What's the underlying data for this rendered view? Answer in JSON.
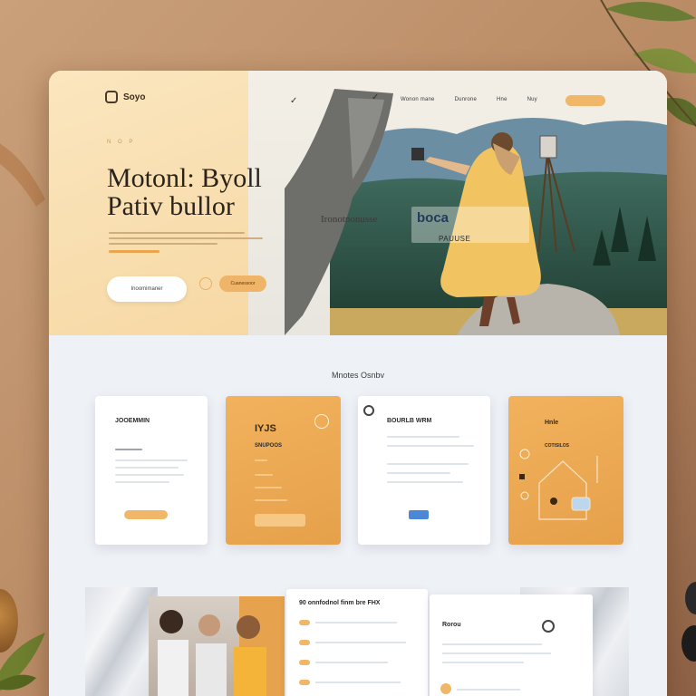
{
  "nav": {
    "brand": "Soyo",
    "links": [
      "Wonon mane",
      "Dunrone",
      "Hne",
      "Nuy"
    ]
  },
  "hero": {
    "eyebrow": "N O P",
    "headline_line1": "Motonl: Byoll",
    "headline_line2": "Pativ bullor",
    "primary_button": "Inoomimaner",
    "secondary_button": "Cuanessoor",
    "photo_caption_a": "Ironotnonusse",
    "photo_caption_b": "boca",
    "photo_caption_c": "PAUUSE"
  },
  "services": {
    "title": "Mnotes Osnbv",
    "cards": [
      {
        "title": "JOOEMMIN",
        "style": "white"
      },
      {
        "title": "IYJS",
        "subtitle": "SNUPOOS",
        "style": "orange"
      },
      {
        "title": "BOURLB WRM",
        "style": "white"
      },
      {
        "title": "Hnle",
        "subtitle": "COTISILOS",
        "style": "orange"
      }
    ]
  },
  "team": {
    "panel_title": "90 onnfodnol finm bre FHX",
    "side_title": "Rorou"
  },
  "colors": {
    "accent": "#f0b768",
    "peach": "#f7e4bf",
    "page_bg": "#eef1f6",
    "text_dark": "#2a231c"
  }
}
